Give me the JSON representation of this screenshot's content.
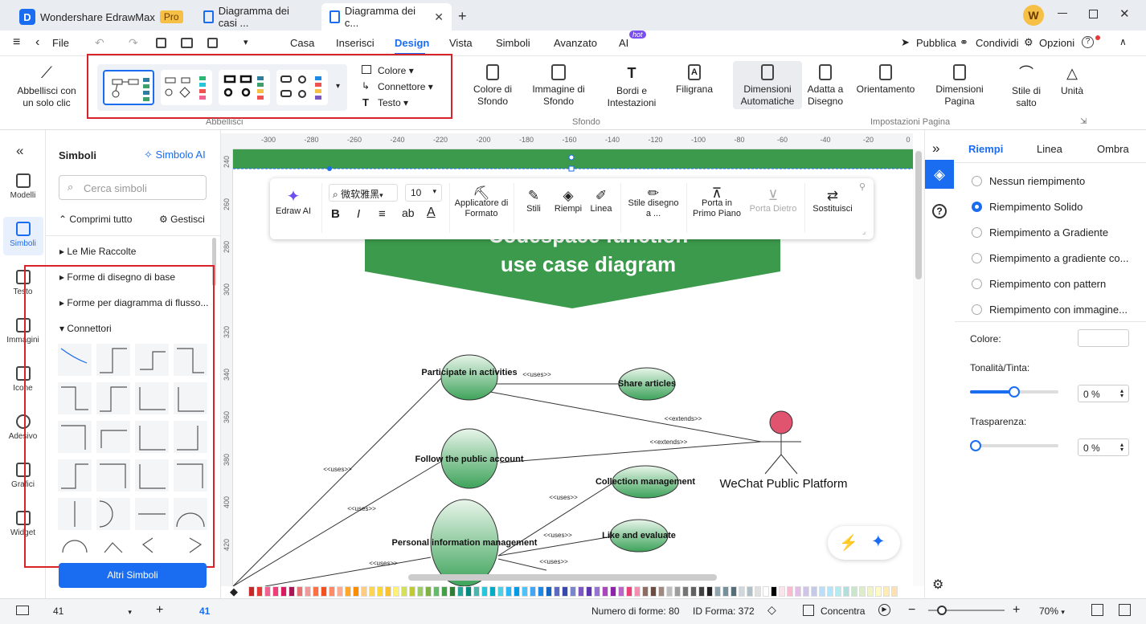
{
  "app": {
    "name": "Wondershare EdrawMax",
    "badge": "Pro"
  },
  "tabs": [
    {
      "label": "Diagramma dei casi ..."
    },
    {
      "label": "Diagramma dei c..."
    }
  ],
  "user_initial": "W",
  "menu": {
    "file": "File",
    "items": [
      "Casa",
      "Inserisci",
      "Design",
      "Vista",
      "Simboli",
      "Avanzato",
      "AI"
    ],
    "hot": "hot",
    "right": [
      "Pubblica",
      "Condividi",
      "Opzioni"
    ]
  },
  "ribbon": {
    "beautify": "Abbellisci con un solo clic",
    "color": "Colore",
    "connector": "Connettore",
    "text": "Testo",
    "bg_color": "Colore di Sfondo",
    "bg_image": "Immagine di Sfondo",
    "borders": "Bordi e Intestazioni",
    "watermark": "Filigrana",
    "auto_size": "Dimensioni Automatiche",
    "fit": "Adatta a Disegno",
    "orientation": "Orientamento",
    "page_size": "Dimensioni Pagina",
    "jump": "Stile di salto",
    "unit": "Unità",
    "groups": {
      "beautify": "Abbellisci",
      "background": "Sfondo",
      "page_setup": "Impostazioni Pagina"
    }
  },
  "rail": [
    "Modelli",
    "Simboli",
    "Testo",
    "Immagini",
    "Icone",
    "Adesivo",
    "Grafici",
    "Widget"
  ],
  "panel": {
    "title": "Simboli",
    "ai": "Simbolo AI",
    "search_placeholder": "Cerca simboli",
    "collapse": "Comprimi tutto",
    "manage": "Gestisci",
    "sections": [
      "Le Mie Raccolte",
      "Forme di disegno di base",
      "Forme per diagramma di flusso...",
      "Connettori"
    ],
    "more": "Altri Simboli"
  },
  "ruler_x": [
    "-300",
    "-280",
    "-260",
    "-240",
    "-220",
    "-200",
    "-180",
    "-160",
    "-140",
    "-120",
    "-100",
    "-80",
    "-60",
    "-40",
    "-20",
    "0"
  ],
  "ruler_y": [
    "240",
    "260",
    "280",
    "300",
    "320",
    "340",
    "360",
    "380",
    "400",
    "420"
  ],
  "toolbar": {
    "ai": "Edraw AI",
    "font": "微软雅黑",
    "size": "10",
    "painter": "Applicatore di Formato",
    "styles": "Stili",
    "fill": "Riempi",
    "line": "Linea",
    "draw_style": "Stile disegno a ...",
    "front": "Porta in Primo Piano",
    "back": "Porta Dietro",
    "replace": "Sostituisci"
  },
  "diagram": {
    "title_line1": "Codespace function",
    "title_line2": "use case diagram",
    "nodes": {
      "participate": "Participate in activities",
      "share": "Share articles",
      "follow": "Follow the public account",
      "collection": "Collection management",
      "personal": "Personal information management",
      "like": "Like and evaluate"
    },
    "actor": "WeChat Public Platform",
    "rel": {
      "uses": "<<uses>>",
      "extends": "<<extends>>"
    }
  },
  "rpanel": {
    "tabs": [
      "Riempi",
      "Linea",
      "Ombra"
    ],
    "options": [
      "Nessun riempimento",
      "Riempimento Solido",
      "Riempimento a Gradiente",
      "Riempimento a gradiente co...",
      "Riempimento con pattern",
      "Riempimento con immagine..."
    ],
    "color_label": "Colore:",
    "tint_label": "Tonalità/Tinta:",
    "tint_value": "0 %",
    "transparency_label": "Trasparenza:",
    "transparency_value": "0 %"
  },
  "status": {
    "page": "41",
    "page_tab": "41",
    "shapes": "Numero di forme: 80",
    "shape_id": "ID Forma: 372",
    "focus": "Concentra",
    "zoom": "70%"
  },
  "palette": [
    "#c62828",
    "#e53935",
    "#f06292",
    "#ec407a",
    "#d81b60",
    "#ad1457",
    "#e57373",
    "#ef9a9a",
    "#ff7043",
    "#f4511e",
    "#ff8a65",
    "#ffab91",
    "#ffa726",
    "#fb8c00",
    "#ffcc80",
    "#ffd54f",
    "#fdd835",
    "#fbc02d",
    "#fff176",
    "#d4e157",
    "#c0ca33",
    "#9ccc65",
    "#7cb342",
    "#66bb6a",
    "#43a047",
    "#2e7d32",
    "#26a69a",
    "#00897b",
    "#4db6ac",
    "#26c6da",
    "#00acc1",
    "#4dd0e1",
    "#29b6f6",
    "#039be5",
    "#4fc3f7",
    "#42a5f5",
    "#1e88e5",
    "#1565c0",
    "#5c6bc0",
    "#3949ab",
    "#7986cb",
    "#7e57c2",
    "#5e35b1",
    "#9575cd",
    "#ab47bc",
    "#8e24aa",
    "#ba68c8",
    "#ec407a",
    "#f48fb1",
    "#8d6e63",
    "#6d4c41",
    "#a1887f",
    "#bdbdbd",
    "#9e9e9e",
    "#757575",
    "#616161",
    "#424242",
    "#212121",
    "#90a4ae",
    "#78909c",
    "#546e7a",
    "#cfd8dc",
    "#b0bec5",
    "#e0e0e0",
    "#ffffff",
    "#000000",
    "#fce4ec",
    "#f8bbd0",
    "#e1bee7",
    "#d1c4e9",
    "#c5cae9",
    "#bbdefb",
    "#b3e5fc",
    "#b2ebf2",
    "#b2dfdb",
    "#c8e6c9",
    "#dcedc8",
    "#f0f4c3",
    "#fff9c4",
    "#ffecb3",
    "#ffe0b2"
  ]
}
